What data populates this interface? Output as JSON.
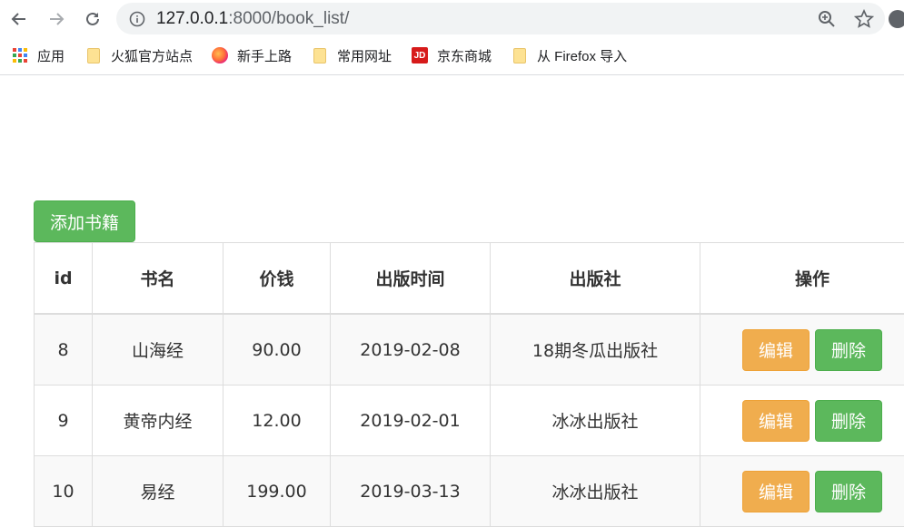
{
  "browser": {
    "url_host": "127.0.0.1",
    "url_path": ":8000/book_list/",
    "bookmarks": [
      {
        "label": "应用",
        "icon": "apps-grid-icon"
      },
      {
        "label": "火狐官方站点",
        "icon": "folder-icon"
      },
      {
        "label": "新手上路",
        "icon": "firefox-icon"
      },
      {
        "label": "常用网址",
        "icon": "folder-icon"
      },
      {
        "label": "京东商城",
        "icon": "jd-icon"
      },
      {
        "label": "从 Firefox 导入",
        "icon": "folder-icon"
      }
    ]
  },
  "page": {
    "add_button": "添加书籍",
    "table": {
      "headers": [
        "id",
        "书名",
        "价钱",
        "出版时间",
        "出版社",
        "操作"
      ],
      "rows": [
        {
          "id": "8",
          "title": "山海经",
          "price": "90.00",
          "date": "2019-02-08",
          "publisher": "18期冬瓜出版社",
          "edit": "编辑",
          "delete": "删除"
        },
        {
          "id": "9",
          "title": "黄帝内经",
          "price": "12.00",
          "date": "2019-02-01",
          "publisher": "冰冰出版社",
          "edit": "编辑",
          "delete": "删除"
        },
        {
          "id": "10",
          "title": "易经",
          "price": "199.00",
          "date": "2019-03-13",
          "publisher": "冰冰出版社",
          "edit": "编辑",
          "delete": "删除"
        }
      ]
    }
  },
  "colors": {
    "success": "#5cb85c",
    "warning": "#f0ad4e"
  }
}
